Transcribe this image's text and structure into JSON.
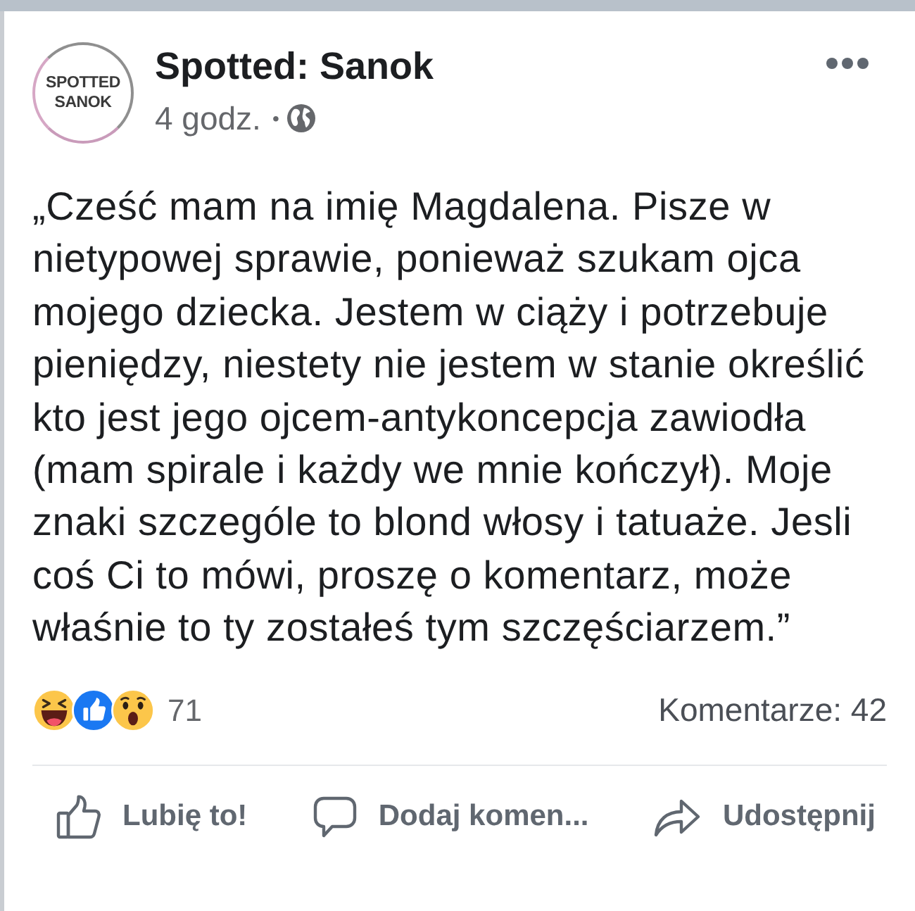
{
  "post": {
    "avatar_text": "SPOTTED SANOK",
    "author": "Spotted: Sanok",
    "time": "4 godz.",
    "separator": "•",
    "text": "„Cześć mam na imię Magdalena. Pisze w nietypowej sprawie, ponieważ szukam ojca mojego dziecka. Jestem w ciąży i potrzebuje pieniędzy, niestety nie jestem w stanie określić kto jest jego ojcem-antykoncepcja zawiodła (mam spirale i każdy we mnie kończył). Moje znaki szczególe to blond włosy i tatuaże. Jesli coś Ci to mówi, proszę o komentarz, może właśnie to ty zostałeś tym szczęściarzem.”"
  },
  "stats": {
    "reactions_count": "71",
    "comments": "Komentarze: 42"
  },
  "actions": [
    {
      "kind": "like",
      "label": "Lubię to!"
    },
    {
      "kind": "comment",
      "label": "Dodaj komen..."
    },
    {
      "kind": "share",
      "label": "Udostępnij"
    }
  ]
}
